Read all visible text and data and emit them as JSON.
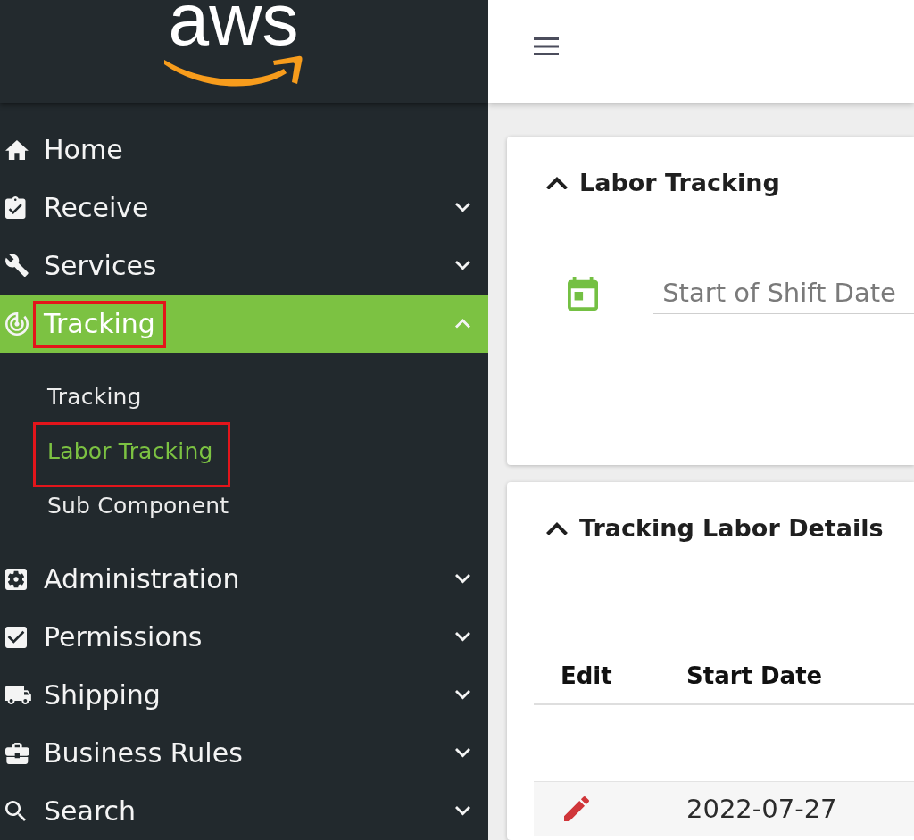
{
  "sidebar": {
    "logo": {
      "text": "aws"
    },
    "items": [
      {
        "kind": "link",
        "label": "Home",
        "selected": false,
        "highlighted": false
      },
      {
        "kind": "group",
        "label": "Receive",
        "selected": false,
        "expanded": false,
        "highlighted": false
      },
      {
        "kind": "group",
        "label": "Services",
        "selected": false,
        "expanded": false,
        "highlighted": false
      },
      {
        "kind": "group",
        "label": "Tracking",
        "selected": true,
        "expanded": true,
        "highlighted": true,
        "children": [
          {
            "label": "Tracking",
            "selected": false,
            "highlighted": false
          },
          {
            "label": "Labor Tracking",
            "selected": true,
            "highlighted": true
          },
          {
            "label": "Sub Component",
            "selected": false,
            "highlighted": false
          }
        ]
      },
      {
        "kind": "group",
        "label": "Administration",
        "selected": false,
        "expanded": false,
        "highlighted": false
      },
      {
        "kind": "group",
        "label": "Permissions",
        "selected": false,
        "expanded": false,
        "highlighted": false
      },
      {
        "kind": "group",
        "label": "Shipping",
        "selected": false,
        "expanded": false,
        "highlighted": false
      },
      {
        "kind": "group",
        "label": "Business Rules",
        "selected": false,
        "expanded": false,
        "highlighted": false
      },
      {
        "kind": "group",
        "label": "Search",
        "selected": false,
        "expanded": false,
        "highlighted": false
      }
    ]
  },
  "cards": [
    {
      "kind": "form",
      "title": "Labor Tracking",
      "expanded": true,
      "fields": [
        {
          "kind": "date",
          "placeholder": "Start of Shift Date"
        }
      ]
    },
    {
      "kind": "table",
      "title": "Tracking Labor Details",
      "expanded": true,
      "table": {
        "columns": [
          {
            "label": "Edit",
            "filter": false
          },
          {
            "label": "Start Date",
            "filter": true
          }
        ],
        "rows": [
          {
            "cells": [
              {
                "kind": "edit"
              },
              {
                "kind": "text",
                "text": "2022-07-27"
              }
            ]
          }
        ]
      }
    }
  ]
}
